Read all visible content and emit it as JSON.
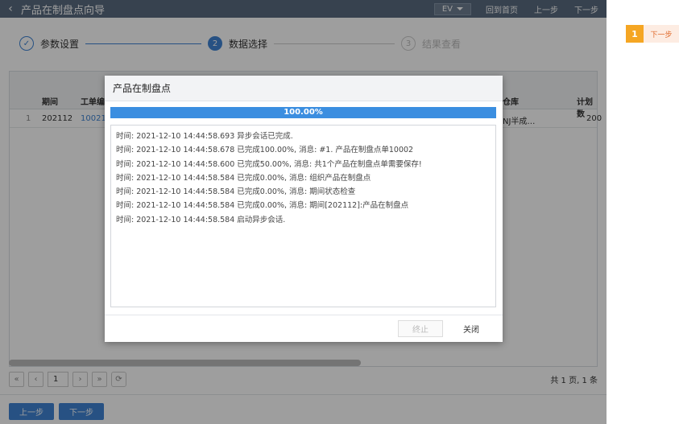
{
  "header": {
    "back_glyph": "‹",
    "title": "产品在制盘点向导",
    "ev_label": "EV",
    "home_label": "回到首页",
    "prev_label": "上一步",
    "next_label": "下一步"
  },
  "steps": [
    {
      "number": "✓",
      "label": "参数设置"
    },
    {
      "number": "2",
      "label": "数据选择"
    },
    {
      "number": "3",
      "label": "结果查看"
    }
  ],
  "grid": {
    "columns": [
      "期间",
      "工单编",
      "仓库",
      "计划数"
    ],
    "rows": [
      {
        "index": "1",
        "period": "202112",
        "order": "10021",
        "warehouse": "NJ半成…",
        "plan": "200"
      }
    ]
  },
  "pager": {
    "first": "«",
    "prev": "‹",
    "page": "1",
    "next": "›",
    "last": "»",
    "refresh": "⟳",
    "info": "共 1 页, 1 条"
  },
  "footer": {
    "prev_label": "上一步",
    "next_label": "下一步"
  },
  "dialog": {
    "title": "产品在制盘点",
    "progress_value": 100,
    "progress_text": "100.00%",
    "log": [
      "时间: 2021-12-10 14:44:58.693 异步会话已完成.",
      "时间: 2021-12-10 14:44:58.678 已完成100.00%, 消息: #1. 产品在制盘点单10002",
      "时间: 2021-12-10 14:44:58.600 已完成50.00%, 消息: 共1个产品在制盘点单需要保存!",
      "时间: 2021-12-10 14:44:58.584 已完成0.00%, 消息: 组织产品在制盘点",
      "时间: 2021-12-10 14:44:58.584 已完成0.00%, 消息: 期间状态检查",
      "时间: 2021-12-10 14:44:58.584 已完成0.00%, 消息: 期间[202112]:产品在制盘点",
      "时间: 2021-12-10 14:44:58.584 启动异步会话."
    ],
    "stop_label": "终止",
    "close_label": "关闭"
  },
  "side": {
    "badge": "1",
    "tip": "下一步"
  },
  "colors": {
    "topbar": "#5a6b80",
    "accent": "#3f84d4",
    "progress": "#3b8ee0",
    "badge": "#f5a623"
  }
}
